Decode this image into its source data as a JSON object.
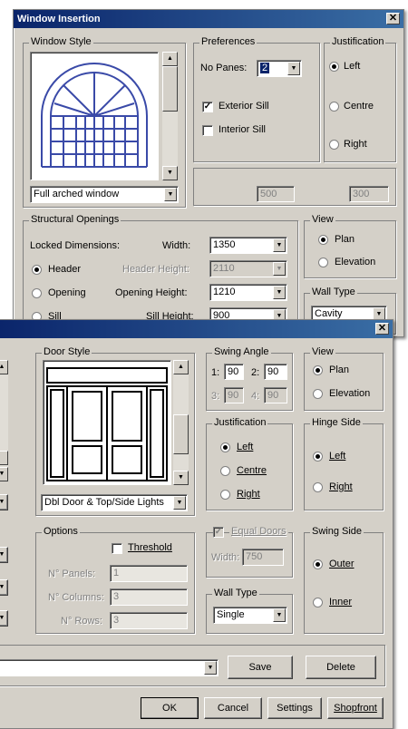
{
  "window_dialog": {
    "title": "Window Insertion",
    "window_style": {
      "legend": "Window Style",
      "style_value": "Full arched window"
    },
    "preferences": {
      "legend": "Preferences",
      "no_panes_label": "No Panes:",
      "no_panes_value": "2",
      "exterior_sill_label": "Exterior Sill",
      "exterior_sill_checked": true,
      "interior_sill_label": "Interior Sill",
      "interior_sill_checked": false,
      "sill_field_1": "500",
      "sill_field_2": "300"
    },
    "justification": {
      "legend": "Justification",
      "options": [
        "Left",
        "Centre",
        "Right"
      ],
      "selected": "Left"
    },
    "structural_openings": {
      "legend": "Structural Openings",
      "locked_label": "Locked Dimensions:",
      "width_label": "Width:",
      "width_value": "1350",
      "header_label": "Header",
      "header_height_label": "Header Height:",
      "header_height_value": "2110",
      "opening_label": "Opening",
      "opening_height_label": "Opening Height:",
      "opening_height_value": "1210",
      "sill_label": "Sill",
      "sill_height_label": "Sill Height:",
      "sill_height_value": "900",
      "selected": "Header"
    },
    "view": {
      "legend": "View",
      "options": [
        "Plan",
        "Elevation"
      ],
      "selected": "Plan"
    },
    "wall_type": {
      "legend": "Wall Type",
      "value": "Cavity"
    }
  },
  "door_dialog": {
    "close_glyph": "✕",
    "door_style": {
      "legend": "Door Style",
      "style_value": "Dbl Door & Top/Side Lights"
    },
    "swing_angle": {
      "legend": "Swing Angle",
      "a1_label": "1:",
      "a1_value": "90",
      "a2_label": "2:",
      "a2_value": "90",
      "a3_label": "3:",
      "a3_value": "90",
      "a4_label": "4:",
      "a4_value": "90"
    },
    "view": {
      "legend": "View",
      "options": [
        "Plan",
        "Elevation"
      ],
      "selected": "Plan"
    },
    "justification": {
      "legend": "Justification",
      "options": [
        "Left",
        "Centre",
        "Right"
      ],
      "selected": "Left"
    },
    "hinge_side": {
      "legend": "Hinge Side",
      "options": [
        "Left",
        "Right"
      ],
      "selected": "Left"
    },
    "options": {
      "legend": "Options",
      "threshold_label": "Threshold",
      "threshold_checked": false,
      "panels_label": "N° Panels:",
      "panels_value": "1",
      "columns_label": "N° Columns:",
      "columns_value": "3",
      "rows_label": "N° Rows:",
      "rows_value": "3"
    },
    "equal_doors": {
      "label": "Equal Doors",
      "width_label": "Width:",
      "width_value": "750"
    },
    "wall_type": {
      "legend": "Wall Type",
      "value": "Single"
    },
    "swing_side": {
      "legend": "Swing Side",
      "options": [
        "Outer",
        "Inner"
      ],
      "selected": "Outer"
    },
    "buttons": {
      "save": "Save",
      "delete": "Delete",
      "ok": "OK",
      "cancel": "Cancel",
      "settings": "Settings",
      "shopfront": "Shopfront"
    }
  },
  "colors": {
    "title_bar": "#0a246a",
    "dialog_face": "#d4d0c8",
    "window_drawing": "#3a4aa8"
  }
}
